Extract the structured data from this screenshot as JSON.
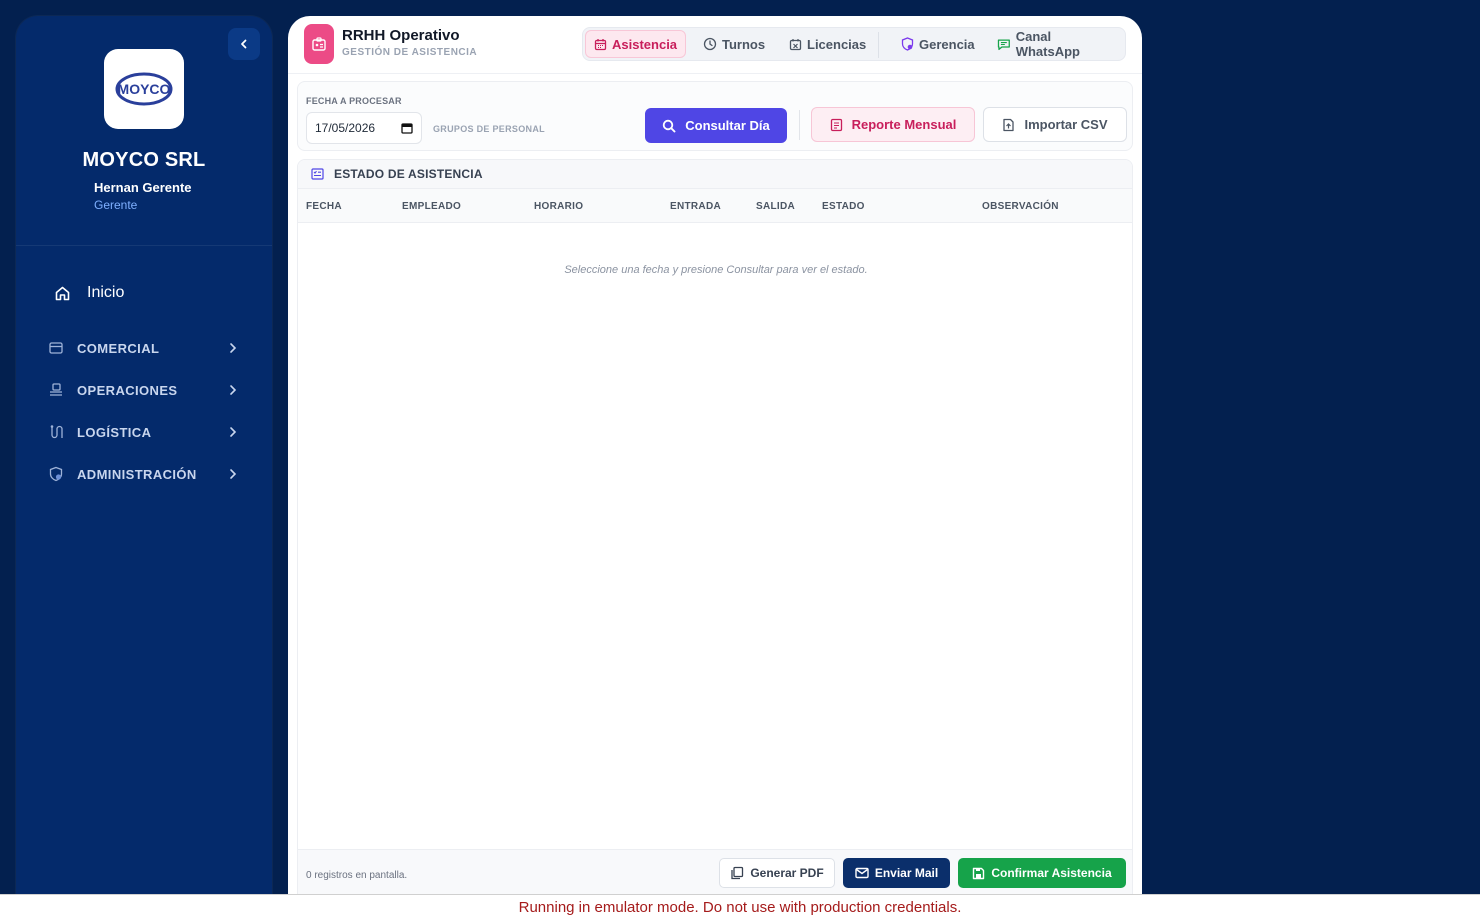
{
  "sidebar": {
    "company_name": "MOYCO SRL",
    "logo_text": "MOYCO",
    "user_name": "Hernan Gerente",
    "user_role": "Gerente",
    "home_label": "Inicio",
    "sections": [
      {
        "label": "COMERCIAL",
        "icon": "store-icon"
      },
      {
        "label": "OPERACIONES",
        "icon": "operations-icon"
      },
      {
        "label": "LOGÍSTICA",
        "icon": "route-icon"
      },
      {
        "label": "ADMINISTRACIÓN",
        "icon": "shield-gear-icon"
      }
    ]
  },
  "header": {
    "title": "RRHH Operativo",
    "subtitle": "GESTIÓN DE ASISTENCIA",
    "tabs": [
      {
        "label": "Asistencia",
        "icon": "calendar-icon",
        "active": true
      },
      {
        "label": "Turnos",
        "icon": "clock-icon",
        "active": false
      },
      {
        "label": "Licencias",
        "icon": "calendar-x-icon",
        "active": false
      },
      {
        "label": "Gerencia",
        "icon": "shield-icon",
        "active": false
      },
      {
        "label": "Canal WhatsApp",
        "icon": "message-icon",
        "active": false
      }
    ]
  },
  "filters": {
    "date_label": "FECHA A PROCESAR",
    "date_value": "17/05/2026",
    "groups_label": "GRUPOS DE PERSONAL",
    "consult_label": "Consultar Día",
    "report_label": "Reporte Mensual",
    "import_label": "Importar CSV"
  },
  "table": {
    "title": "ESTADO DE ASISTENCIA",
    "columns": [
      "FECHA",
      "EMPLEADO",
      "HORARIO",
      "ENTRADA",
      "SALIDA",
      "ESTADO",
      "OBSERVACIÓN"
    ],
    "empty_message": "Seleccione una fecha y presione Consultar para ver el estado.",
    "row_count_text": "0 registros en pantalla.",
    "pdf_label": "Generar PDF",
    "mail_label": "Enviar Mail",
    "confirm_label": "Confirmar Asistencia"
  },
  "emulator_notice": "Running in emulator mode. Do not use with production credentials.",
  "colors": {
    "background": "#03204f",
    "sidebar": "#042a6b",
    "accent_pink": "#c81e5b",
    "primary": "#4f46e5",
    "confirm": "#16a34a",
    "mail": "#0b2f6b"
  }
}
